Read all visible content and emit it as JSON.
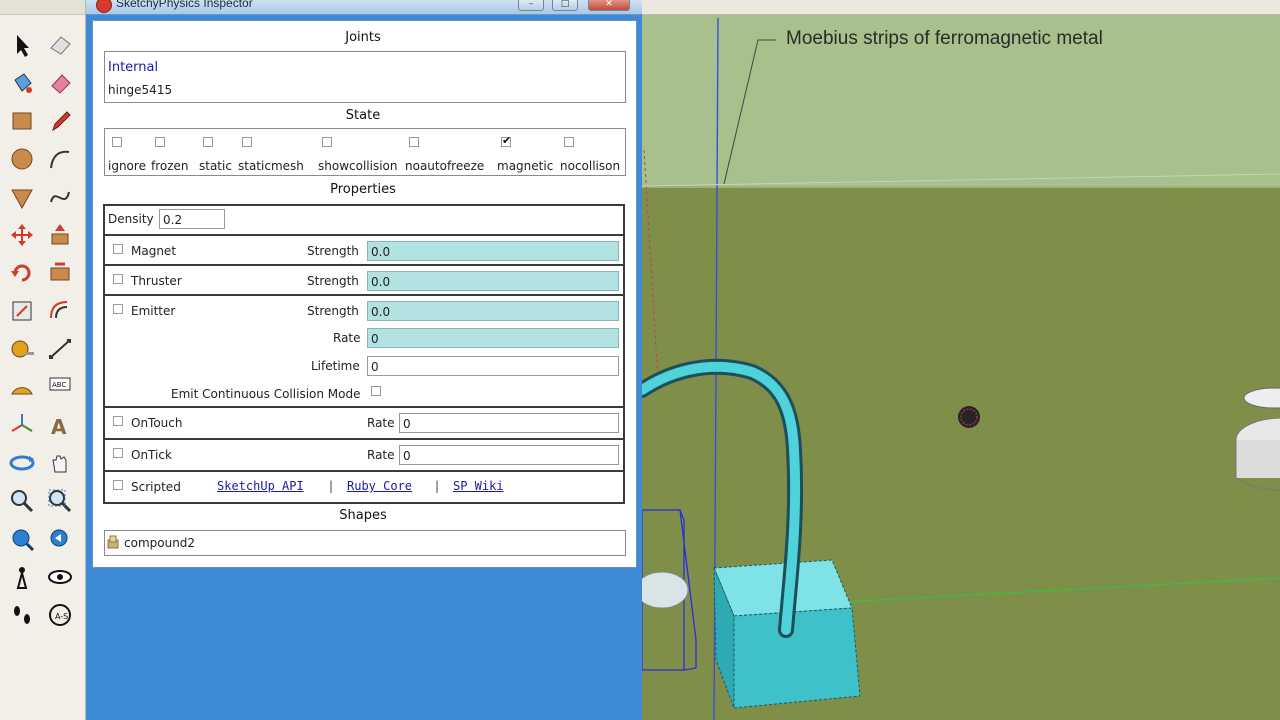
{
  "window": {
    "title": "SketchyPhysics Inspector",
    "minimize": "–",
    "maximize": "□",
    "close": "✕"
  },
  "joints": {
    "heading": "Joints",
    "type": "Internal",
    "name": "hinge5415"
  },
  "state": {
    "heading": "State",
    "items": [
      {
        "label": "ignore",
        "checked": false
      },
      {
        "label": "frozen",
        "checked": false
      },
      {
        "label": "static",
        "checked": false
      },
      {
        "label": "staticmesh",
        "checked": false
      },
      {
        "label": "showcollision",
        "checked": false
      },
      {
        "label": "noautofreeze",
        "checked": false
      },
      {
        "label": "magnetic",
        "checked": true
      },
      {
        "label": "nocollison",
        "checked": false
      }
    ]
  },
  "properties": {
    "heading": "Properties",
    "density": {
      "label": "Density",
      "value": "0.2"
    },
    "magnet": {
      "label": "Magnet",
      "strength_label": "Strength",
      "strength": "0.0"
    },
    "thruster": {
      "label": "Thruster",
      "strength_label": "Strength",
      "strength": "0.0"
    },
    "emitter": {
      "label": "Emitter",
      "strength_label": "Strength",
      "strength": "0.0",
      "rate_label": "Rate",
      "rate": "0",
      "lifetime_label": "Lifetime",
      "lifetime": "0",
      "ccd_label": "Emit Continuous Collision Mode"
    },
    "ontouch": {
      "label": "OnTouch",
      "rate_label": "Rate",
      "rate": "0"
    },
    "ontick": {
      "label": "OnTick",
      "rate_label": "Rate",
      "rate": "0"
    },
    "scripted": {
      "label": "Scripted",
      "links": [
        "SketchUp API",
        "Ruby Core",
        "SP Wiki"
      ],
      "separator": "|"
    }
  },
  "shapes": {
    "heading": "Shapes",
    "item": "compound2"
  },
  "viewport": {
    "annotation": "Moebius strips of ferromagnetic metal"
  },
  "toolbar": {
    "tools": [
      "select-icon",
      "eraser-icon",
      "paint-bucket-icon",
      "rubber-icon",
      "rectangle-icon",
      "pencil-icon",
      "circle-icon",
      "arc-icon",
      "polygon-icon",
      "freehand-icon",
      "move-icon",
      "push-pull-icon",
      "rotate-icon",
      "follow-me-icon",
      "scale-icon",
      "offset-icon",
      "tape-measure-icon",
      "dimension-icon",
      "protractor-icon",
      "text-label-icon",
      "axes-icon",
      "3d-text-icon",
      "orbit-icon",
      "pan-icon",
      "zoom-icon",
      "zoom-window-icon",
      "zoom-extents-icon",
      "previous-view-icon",
      "position-camera-icon",
      "look-around-icon",
      "walk-icon",
      "section-plane-icon"
    ]
  },
  "colors": {
    "accent": "#3f8ad6",
    "teal_field": "#b2e2e2",
    "link": "#1a1aa8",
    "ground": "#7f8f4a",
    "sky": "#a7c08c",
    "object": "#3ec1c9"
  }
}
